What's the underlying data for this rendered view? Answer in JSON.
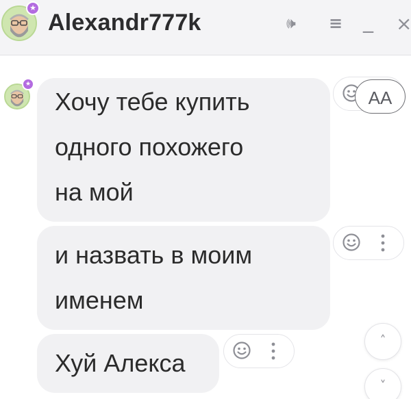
{
  "header": {
    "title": "Alexandr777k",
    "star_badge": "★",
    "speaker_icon": "🕪",
    "menu_icon": "≡",
    "minimize_icon": "_",
    "close_icon": "×"
  },
  "messages": [
    {
      "lines": [
        "Хочу тебе купить",
        "одного похожего",
        "на мой"
      ]
    },
    {
      "lines": [
        "и назвать в моим",
        "именем"
      ]
    },
    {
      "lines": [
        "Хуй Алекса"
      ]
    }
  ],
  "font_size_button": {
    "label": "AA"
  },
  "icons": {
    "reaction": "smiley-face-icon",
    "more": "vertical-dots-icon",
    "scroll_up": "chevron-up-icon",
    "scroll_down": "chevron-down-icon"
  },
  "glyphs": {
    "dots": "⋮",
    "up": "˄",
    "down": "˅"
  },
  "colors": {
    "header_bg": "#f4f4f6",
    "bubble_bg": "#f1f1f3",
    "star_badge": "#b36be0",
    "avatar_bg": "#cfe6b0"
  }
}
